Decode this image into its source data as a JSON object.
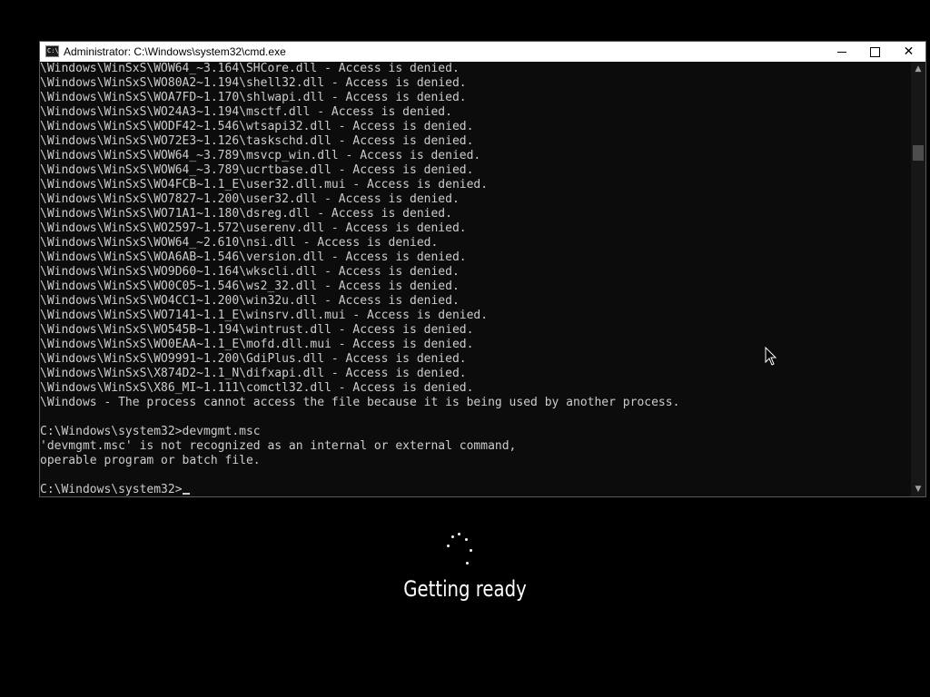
{
  "window": {
    "title": "Administrator: C:\\Windows\\system32\\cmd.exe",
    "icon": "cmd-icon",
    "icon_text": "C:\\",
    "controls": {
      "minimize": "minimize-icon",
      "maximize": "maximize-icon",
      "close": "✕"
    }
  },
  "console": {
    "lines": [
      "\\Windows\\WinSxS\\WOW64_~3.164\\SHCore.dll - Access is denied.",
      "\\Windows\\WinSxS\\WO80A2~1.194\\shell32.dll - Access is denied.",
      "\\Windows\\WinSxS\\WOA7FD~1.170\\shlwapi.dll - Access is denied.",
      "\\Windows\\WinSxS\\WO24A3~1.194\\msctf.dll - Access is denied.",
      "\\Windows\\WinSxS\\WODF42~1.546\\wtsapi32.dll - Access is denied.",
      "\\Windows\\WinSxS\\WO72E3~1.126\\taskschd.dll - Access is denied.",
      "\\Windows\\WinSxS\\WOW64_~3.789\\msvcp_win.dll - Access is denied.",
      "\\Windows\\WinSxS\\WOW64_~3.789\\ucrtbase.dll - Access is denied.",
      "\\Windows\\WinSxS\\WO4FCB~1.1_E\\user32.dll.mui - Access is denied.",
      "\\Windows\\WinSxS\\WO7827~1.200\\user32.dll - Access is denied.",
      "\\Windows\\WinSxS\\WO71A1~1.180\\dsreg.dll - Access is denied.",
      "\\Windows\\WinSxS\\WO2597~1.572\\userenv.dll - Access is denied.",
      "\\Windows\\WinSxS\\WOW64_~2.610\\nsi.dll - Access is denied.",
      "\\Windows\\WinSxS\\WOA6AB~1.546\\version.dll - Access is denied.",
      "\\Windows\\WinSxS\\WO9D60~1.164\\wkscli.dll - Access is denied.",
      "\\Windows\\WinSxS\\WO0C05~1.546\\ws2_32.dll - Access is denied.",
      "\\Windows\\WinSxS\\WO4CC1~1.200\\win32u.dll - Access is denied.",
      "\\Windows\\WinSxS\\WO7141~1.1_E\\winsrv.dll.mui - Access is denied.",
      "\\Windows\\WinSxS\\WO545B~1.194\\wintrust.dll - Access is denied.",
      "\\Windows\\WinSxS\\WO0EAA~1.1_E\\mofd.dll.mui - Access is denied.",
      "\\Windows\\WinSxS\\WO9991~1.200\\GdiPlus.dll - Access is denied.",
      "\\Windows\\WinSxS\\X874D2~1.1_N\\difxapi.dll - Access is denied.",
      "\\Windows\\WinSxS\\X86_MI~1.111\\comctl32.dll - Access is denied.",
      "\\Windows - The process cannot access the file because it is being used by another process.",
      "",
      "C:\\Windows\\system32>devmgmt.msc",
      "'devmgmt.msc' is not recognized as an internal or external command,",
      "operable program or batch file.",
      ""
    ],
    "prompt": "C:\\Windows\\system32>"
  },
  "scrollbar": {
    "up": "▲",
    "down": "▼",
    "position": 0.18
  },
  "overlay": {
    "status_text": "Getting ready",
    "spinner_icon": "loading-spinner-icon"
  },
  "colors": {
    "console_bg": "#0c0c0c",
    "console_text": "#cccccc",
    "desktop_bg": "#000000",
    "titlebar_bg": "#ffffff"
  }
}
